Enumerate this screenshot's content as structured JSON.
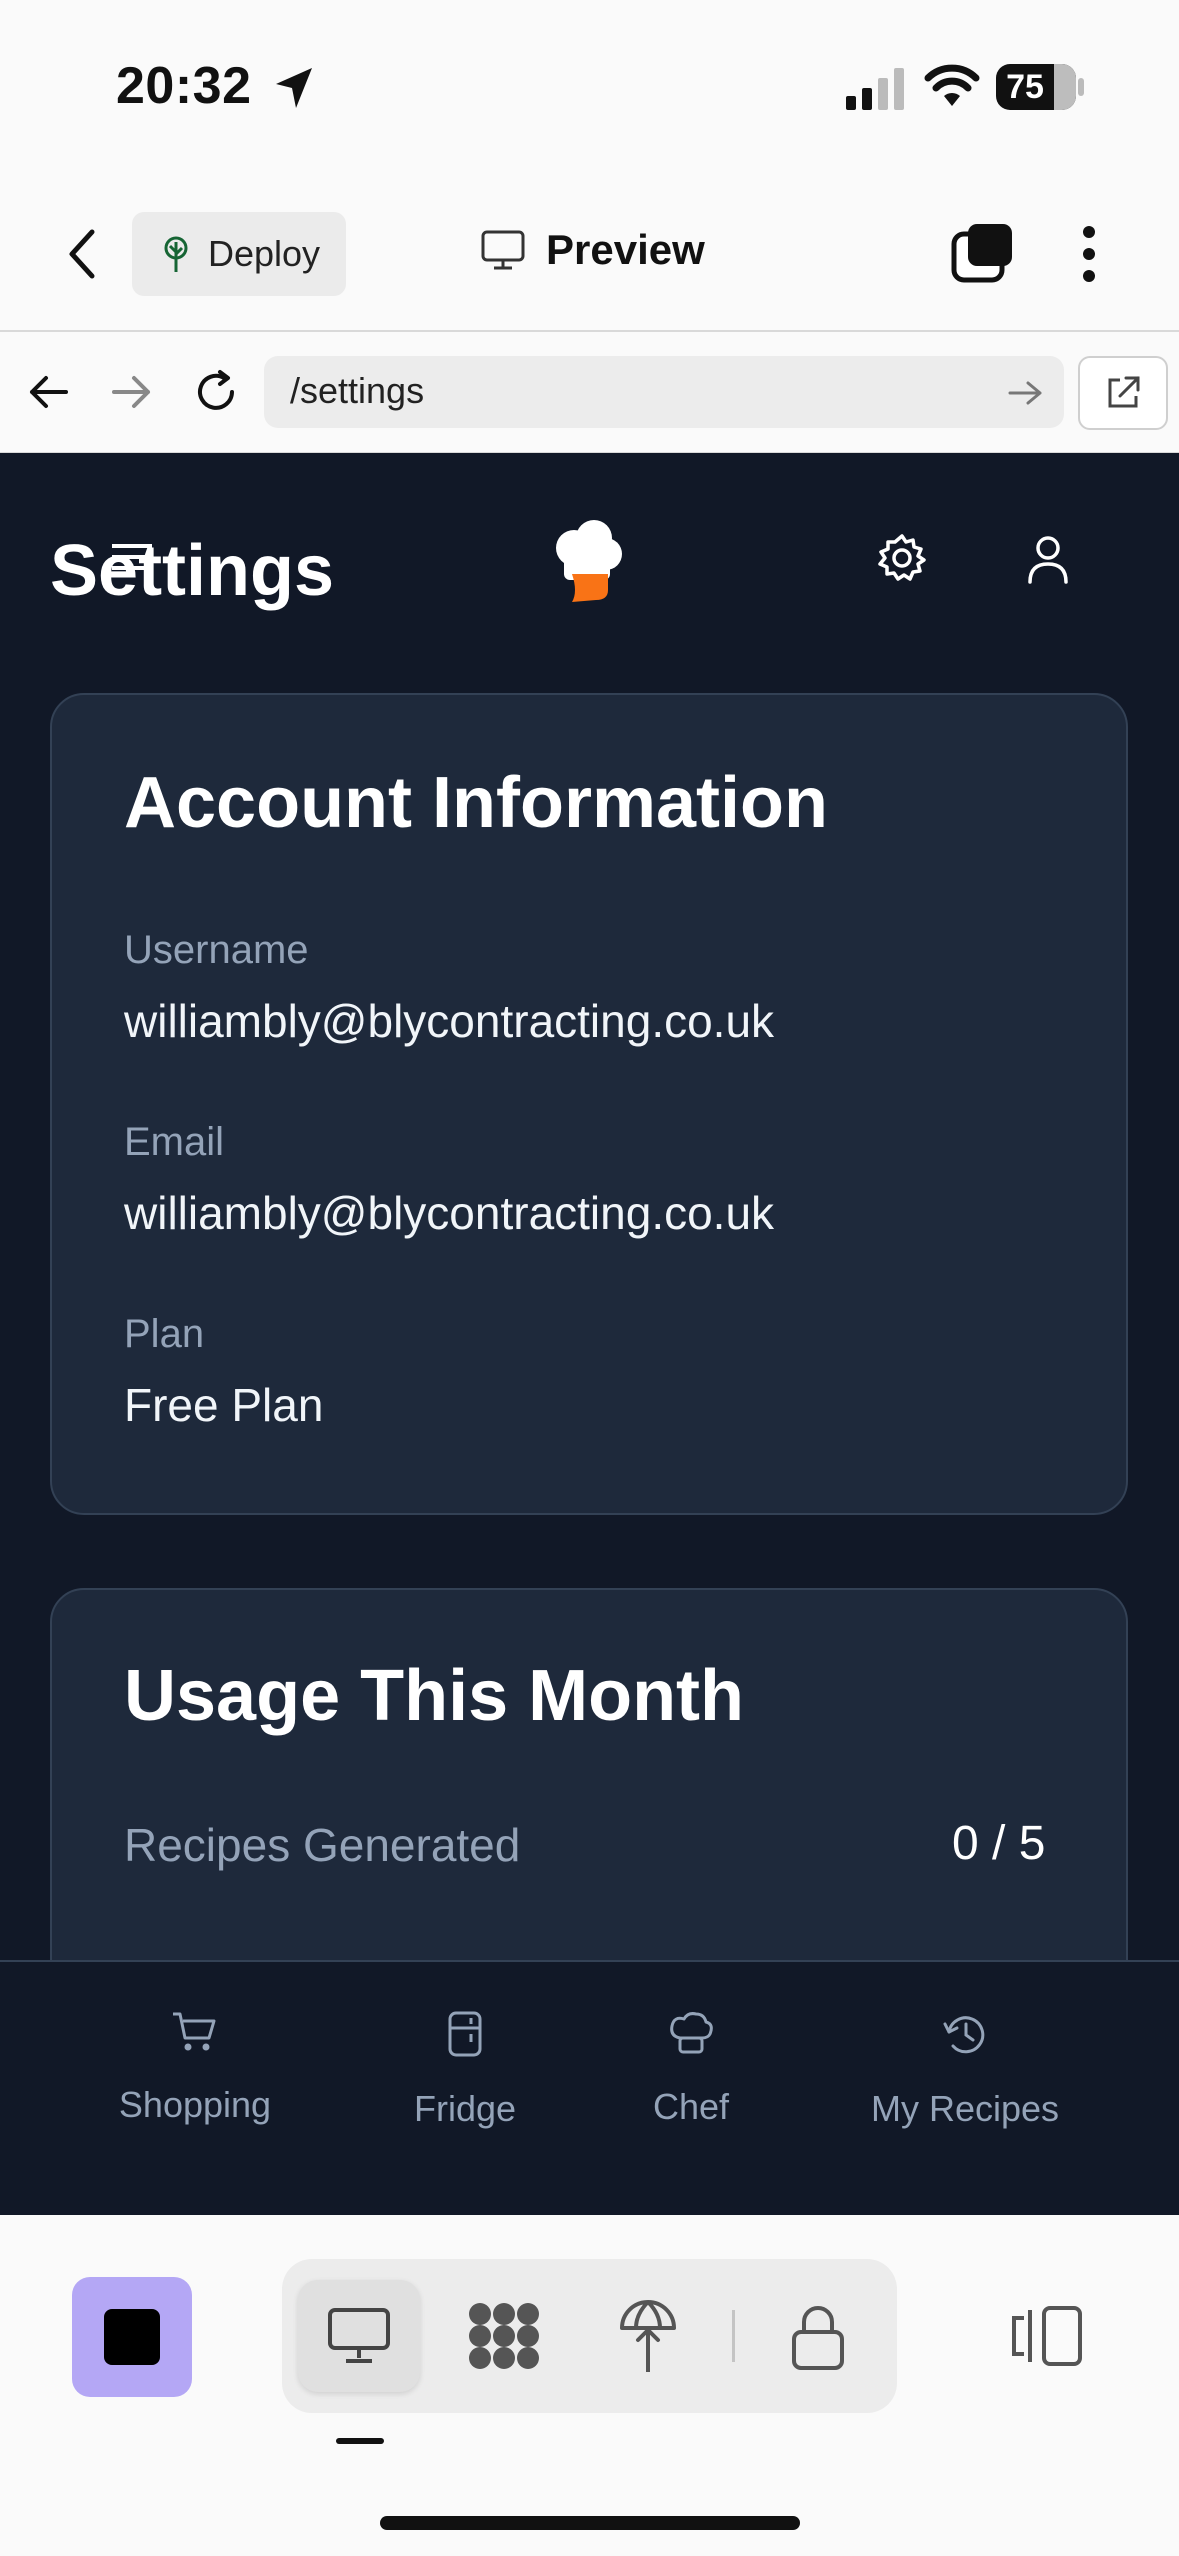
{
  "status_bar": {
    "time": "20:32",
    "battery": "75"
  },
  "topbar": {
    "deploy_label": "Deploy",
    "preview_label": "Preview"
  },
  "urlbar": {
    "url": "/settings"
  },
  "app": {
    "page_title": "Settings",
    "account": {
      "title": "Account Information",
      "username_label": "Username",
      "username_value": "williambly@blycontracting.co.uk",
      "email_label": "Email",
      "email_value": "williambly@blycontracting.co.uk",
      "plan_label": "Plan",
      "plan_value": "Free Plan"
    },
    "usage": {
      "title": "Usage This Month",
      "recipes_label": "Recipes Generated",
      "recipes_value": "0 / 5"
    },
    "bottom_nav": {
      "items": [
        {
          "label": "Shopping",
          "icon": "cart-icon"
        },
        {
          "label": "Fridge",
          "icon": "fridge-icon"
        },
        {
          "label": "Chef",
          "icon": "chef-hat-icon"
        },
        {
          "label": "My Recipes",
          "icon": "history-icon"
        }
      ]
    }
  },
  "colors": {
    "app_bg": "#111827",
    "card_bg": "#1e293b",
    "accent_logo": "#f97316",
    "stop_button": "#b4a7f5"
  }
}
